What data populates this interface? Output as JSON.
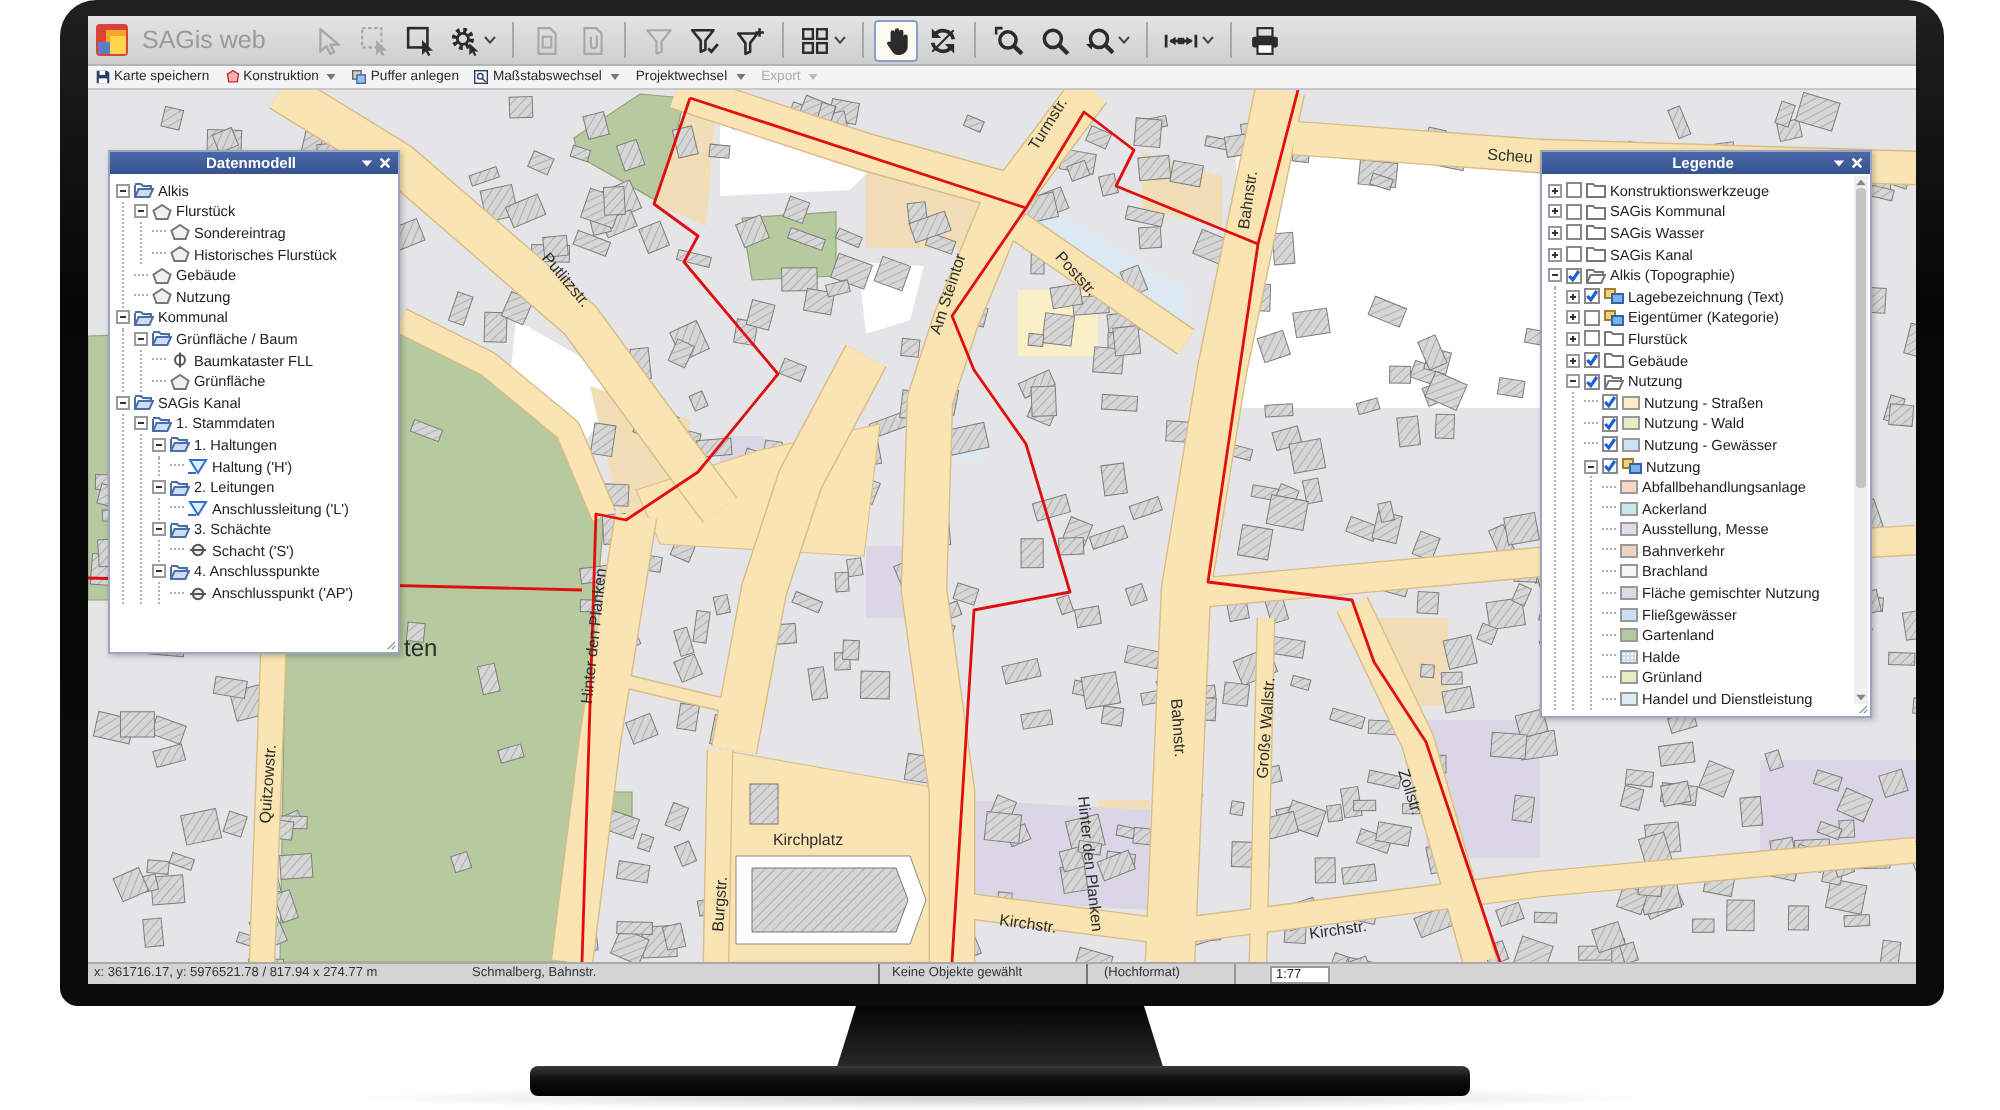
{
  "app": {
    "title": "SAGis web"
  },
  "toolbar": {
    "groups": [
      {
        "tools": [
          {
            "kind": "cursor",
            "disabled": true,
            "selected": false,
            "dropdown": false
          },
          {
            "kind": "dashed_select",
            "disabled": true,
            "selected": false,
            "dropdown": false
          },
          {
            "kind": "box_select",
            "disabled": false,
            "selected": false,
            "dropdown": false
          },
          {
            "kind": "gear",
            "disabled": false,
            "selected": false,
            "dropdown": true
          }
        ]
      },
      {
        "tools": [
          {
            "kind": "document",
            "disabled": true,
            "selected": false,
            "dropdown": false
          },
          {
            "kind": "clip_document",
            "disabled": true,
            "selected": false,
            "dropdown": false
          }
        ]
      },
      {
        "tools": [
          {
            "kind": "filter",
            "disabled": true,
            "selected": false,
            "dropdown": false
          },
          {
            "kind": "filter_check",
            "disabled": false,
            "selected": false,
            "dropdown": false
          },
          {
            "kind": "filter_plus",
            "disabled": false,
            "selected": false,
            "dropdown": false
          }
        ]
      },
      {
        "tools": [
          {
            "kind": "grid",
            "disabled": false,
            "selected": false,
            "dropdown": true
          }
        ]
      },
      {
        "tools": [
          {
            "kind": "hand",
            "disabled": false,
            "selected": true,
            "dropdown": false
          },
          {
            "kind": "refresh",
            "disabled": false,
            "selected": false,
            "dropdown": false
          }
        ]
      },
      {
        "tools": [
          {
            "kind": "zoom_box",
            "disabled": false,
            "selected": false,
            "dropdown": false
          },
          {
            "kind": "magnifier",
            "disabled": false,
            "selected": false,
            "dropdown": false
          },
          {
            "kind": "magnifier_back",
            "disabled": false,
            "selected": false,
            "dropdown": true
          }
        ]
      },
      {
        "tools": [
          {
            "kind": "measure",
            "disabled": false,
            "selected": false,
            "dropdown": true
          }
        ]
      },
      {
        "tools": [
          {
            "kind": "print",
            "disabled": false,
            "selected": false,
            "dropdown": false
          }
        ]
      }
    ]
  },
  "menu": [
    {
      "kind": "save",
      "label": "Karte speichern",
      "dropdown": false,
      "disabled": false
    },
    {
      "kind": "construction",
      "label": "Konstruktion",
      "dropdown": true,
      "disabled": false
    },
    {
      "kind": "buffer",
      "label": "Puffer anlegen",
      "dropdown": false,
      "disabled": false
    },
    {
      "kind": "scale",
      "label": "Maßstabswechsel",
      "dropdown": true,
      "disabled": false
    },
    {
      "kind": "plain",
      "label": "Projektwechsel",
      "dropdown": true,
      "disabled": false
    },
    {
      "kind": "plain",
      "label": "Export",
      "dropdown": true,
      "disabled": true
    }
  ],
  "map": {
    "labels": [
      "Putlitzstr.",
      "Am Steintor",
      "Turmstr.",
      "Poststr.",
      "Bahnstr.",
      "Scheu",
      "Hinter den Planken",
      "ten",
      "Quitzowstr.",
      "Kirchplatz",
      "Burgstr.",
      "Hinter den Planken",
      "Kirchstr.",
      "Bahnstr.",
      "Große Wallstr.",
      "Zollstr.",
      "Kirchstr."
    ]
  },
  "data_model": {
    "title": "Datenmodell",
    "items": [
      {
        "label": "Alkis",
        "kind": "folder",
        "expanded": true,
        "children": [
          {
            "label": "Flurstück",
            "kind": "area",
            "expanded": true,
            "children": [
              {
                "label": "Sondereintrag",
                "kind": "area"
              },
              {
                "label": "Historisches Flurstück",
                "kind": "area"
              }
            ]
          },
          {
            "label": "Gebäude",
            "kind": "area"
          },
          {
            "label": "Nutzung",
            "kind": "area"
          }
        ]
      },
      {
        "label": "Kommunal",
        "kind": "folder",
        "expanded": true,
        "children": [
          {
            "label": "Grünfläche / Baum",
            "kind": "folder",
            "expanded": true,
            "children": [
              {
                "label": "Baumkataster FLL",
                "kind": "point"
              },
              {
                "label": "Grünfläche",
                "kind": "area"
              }
            ]
          }
        ]
      },
      {
        "label": "SAGis Kanal",
        "kind": "folder",
        "expanded": true,
        "children": [
          {
            "label": "1. Stammdaten",
            "kind": "folder",
            "expanded": true,
            "children": [
              {
                "label": "1. Haltungen",
                "kind": "folder",
                "expanded": true,
                "children": [
                  {
                    "label": "Haltung ('H')",
                    "kind": "line"
                  }
                ]
              },
              {
                "label": "2. Leitungen",
                "kind": "folder",
                "expanded": true,
                "children": [
                  {
                    "label": "Anschlussleitung ('L')",
                    "kind": "line"
                  }
                ]
              },
              {
                "label": "3. Schächte",
                "kind": "folder",
                "expanded": true,
                "children": [
                  {
                    "label": "Schacht ('S')",
                    "kind": "node"
                  }
                ]
              },
              {
                "label": "4. Anschlusspunkte",
                "kind": "folder",
                "expanded": true,
                "children": [
                  {
                    "label": "Anschlusspunkt ('AP')",
                    "kind": "node"
                  }
                ]
              }
            ]
          }
        ]
      }
    ]
  },
  "legend": {
    "title": "Legende",
    "items": [
      {
        "label": "Konstruktionswerkzeuge",
        "kind": "group",
        "expanded": false,
        "checked": false
      },
      {
        "label": "SAGis Kommunal",
        "kind": "group",
        "expanded": false,
        "checked": false
      },
      {
        "label": "SAGis Wasser",
        "kind": "group",
        "expanded": false,
        "checked": false
      },
      {
        "label": "SAGis Kanal",
        "kind": "group",
        "expanded": false,
        "checked": false
      },
      {
        "label": "Alkis (Topographie)",
        "kind": "group",
        "expanded": true,
        "checked": true,
        "children": [
          {
            "label": "Lagebezeichnung (Text)",
            "kind": "layer_set",
            "expanded": false,
            "checked": true
          },
          {
            "label": "Eigentümer (Kategorie)",
            "kind": "layer_set",
            "expanded": false,
            "checked": false
          },
          {
            "label": "Flurstück",
            "kind": "group",
            "expanded": false,
            "checked": false
          },
          {
            "label": "Gebäude",
            "kind": "group",
            "expanded": false,
            "checked": true
          },
          {
            "label": "Nutzung",
            "kind": "group",
            "expanded": true,
            "checked": true,
            "children": [
              {
                "label": "Nutzung - Straßen",
                "kind": "layer",
                "checked": true,
                "color": "#fbefc8"
              },
              {
                "label": "Nutzung - Wald",
                "kind": "layer",
                "checked": true,
                "color": "#e3edc6"
              },
              {
                "label": "Nutzung - Gewässer",
                "kind": "layer",
                "checked": true,
                "color": "#cfe0f2"
              },
              {
                "label": "Nutzung",
                "kind": "layer_set",
                "expanded": true,
                "checked": true,
                "children": [
                  {
                    "label": "Abfallbehandlungsanlage",
                    "kind": "class",
                    "color": "#f6d8c4"
                  },
                  {
                    "label": "Ackerland",
                    "kind": "class",
                    "color": "#c9e6ea"
                  },
                  {
                    "label": "Ausstellung, Messe",
                    "kind": "class",
                    "color": "#e2dcea"
                  },
                  {
                    "label": "Bahnverkehr",
                    "kind": "class",
                    "color": "#f0d2c2"
                  },
                  {
                    "label": "Brachland",
                    "kind": "class",
                    "color": "#f6f6f6"
                  },
                  {
                    "label": "Fläche gemischter Nutzung",
                    "kind": "class",
                    "color": "#dedbe6"
                  },
                  {
                    "label": "Fließgewässer",
                    "kind": "class",
                    "color": "#cadff5"
                  },
                  {
                    "label": "Gartenland",
                    "kind": "class",
                    "color": "#b5c9a0"
                  },
                  {
                    "label": "Halde",
                    "kind": "pattern",
                    "color": "#c9dcf2"
                  },
                  {
                    "label": "Grünland",
                    "kind": "class",
                    "color": "#e6edc2"
                  },
                  {
                    "label": "Handel und Dienstleistung",
                    "kind": "class",
                    "color": "#dceef4"
                  }
                ]
              }
            ]
          }
        ]
      }
    ]
  },
  "status_bar": {
    "coordinates": "x: 361716.17, y: 5976521.78 / 817.94 x 274.77 m",
    "location": "Schmalberg, Bahnstr.",
    "selection": "Keine Objekte gewählt",
    "format": "(Hochformat)",
    "scale": "1:77"
  }
}
